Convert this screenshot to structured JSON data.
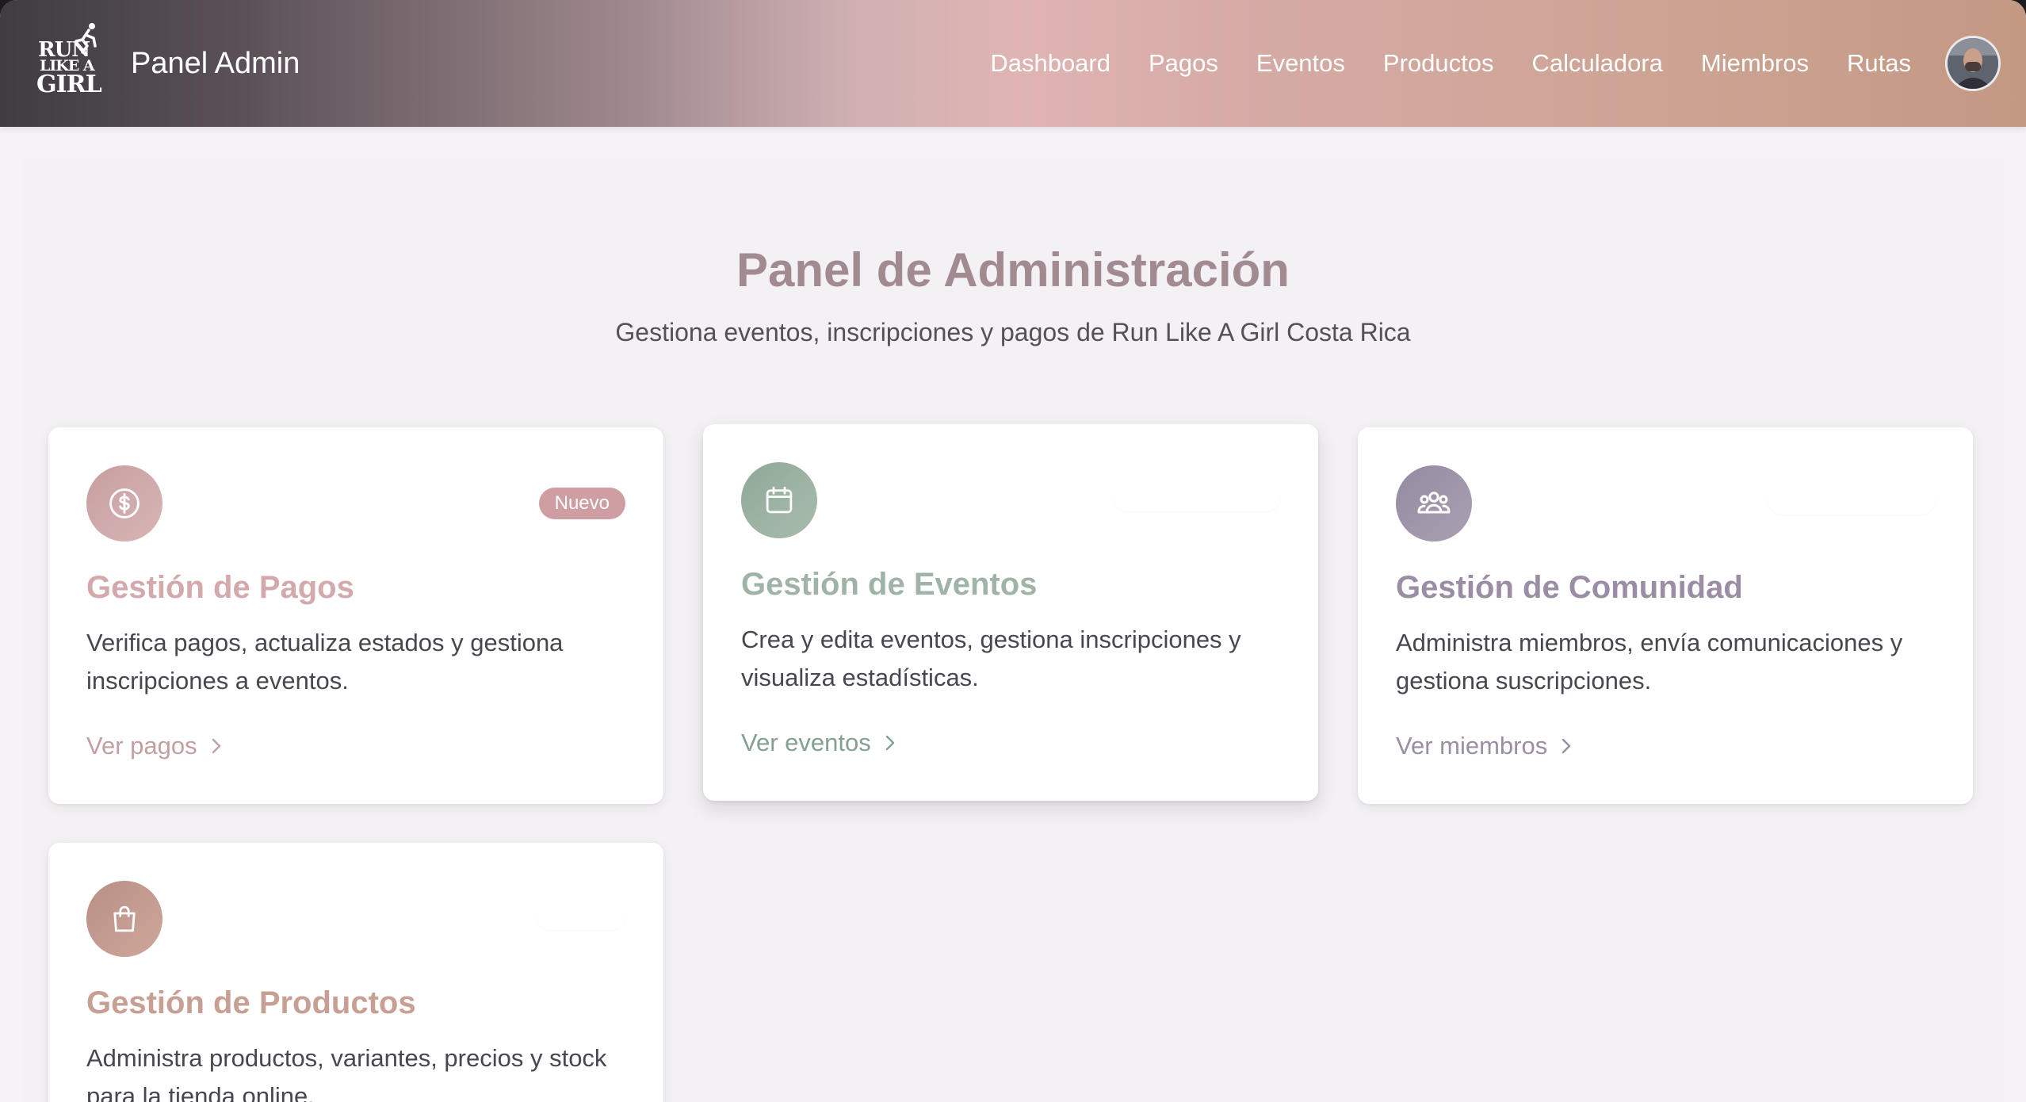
{
  "nav": {
    "logo_lines": [
      "RUN",
      "LIKE A",
      "GIRL"
    ],
    "brand_title": "Panel Admin",
    "links": [
      "Dashboard",
      "Pagos",
      "Eventos",
      "Productos",
      "Calculadora",
      "Miembros",
      "Rutas"
    ]
  },
  "header": {
    "title": "Panel de Administración",
    "subtitle": "Gestiona eventos, inscripciones y pagos de Run Like A Girl Costa Rica"
  },
  "cards": [
    {
      "icon": "dollar-icon",
      "badge": "Nuevo",
      "title": "Gestión de Pagos",
      "description": "Verifica pagos, actualiza estados y gestiona inscripciones a eventos.",
      "link": "Ver pagos",
      "accent": "#c89c9f"
    },
    {
      "icon": "calendar-icon",
      "title": "Gestión de Eventos",
      "description": "Crea y edita eventos, gestiona inscripciones y visualiza estadísticas.",
      "link": "Ver eventos",
      "accent": "#8fa898"
    },
    {
      "icon": "users-icon",
      "title": "Gestión de Comunidad",
      "description": "Administra miembros, envía comunicaciones y gestiona suscripciones.",
      "link": "Ver miembros",
      "accent": "#9b8ea4"
    },
    {
      "icon": "shopping-bag-icon",
      "title": "Gestión de Productos",
      "description": "Administra productos, variantes, precios y stock para la tienda online.",
      "link": "",
      "accent": "#c49a8a"
    }
  ]
}
